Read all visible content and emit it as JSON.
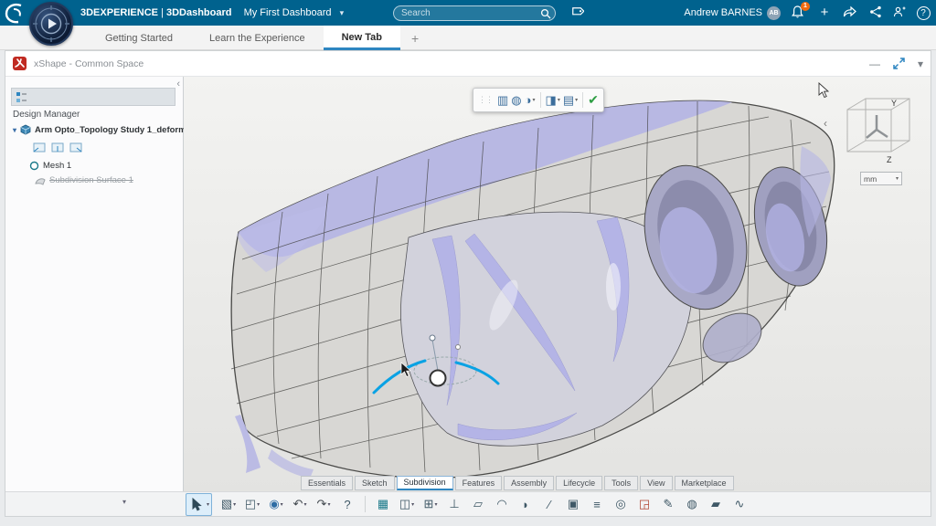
{
  "icons": {
    "caret": "▾",
    "chevron_down": "▾",
    "chevron_left": "‹",
    "plus": "+",
    "minimize": "—",
    "help": "?",
    "grip": "⋮⋮"
  },
  "topbar": {
    "brand": "3DEXPERIENCE",
    "divider": "|",
    "app": "3DDashboard",
    "dashboard": "My First Dashboard",
    "search": {
      "placeholder": "Search"
    },
    "user": {
      "name": "Andrew BARNES",
      "initials": "AB"
    },
    "notifications": {
      "count": "1"
    }
  },
  "tabbar": {
    "tabs": [
      {
        "label": "Getting Started"
      },
      {
        "label": "Learn the Experience"
      },
      {
        "label": "New Tab"
      }
    ]
  },
  "widget": {
    "title": "xShape - Common Space"
  },
  "design_manager": {
    "header": "Design Manager",
    "root_label": "Arm Opto_Topology Study 1_deform...",
    "mesh_label": "Mesh 1",
    "subdivision_label": "Subdivision Surface 1"
  },
  "viewport": {
    "axes": {
      "y": "Y",
      "z": "Z"
    },
    "units": "mm"
  },
  "top_toolbar": {
    "items": [
      {
        "name": "section-table-icon",
        "glyph": "▥"
      },
      {
        "name": "shaded-sphere-icon",
        "glyph": "◍"
      },
      {
        "name": "render-mode-icon",
        "glyph": "◑"
      },
      {
        "name": "display-style-icon",
        "glyph": "◨"
      },
      {
        "name": "layers-icon",
        "glyph": "▤"
      },
      {
        "name": "update-check-icon",
        "glyph": "✔"
      }
    ]
  },
  "section_tabs": {
    "items": [
      "Essentials",
      "Sketch",
      "Subdivision",
      "Features",
      "Assembly",
      "Lifecycle",
      "Tools",
      "View",
      "Marketplace"
    ]
  },
  "bottom_toolbar": {
    "items": [
      {
        "name": "select-tool",
        "glyph": ""
      },
      {
        "name": "subdivision-primitives-tool",
        "glyph": "▧"
      },
      {
        "name": "convert-tool",
        "glyph": "◰"
      },
      {
        "name": "sculpt-tool",
        "glyph": "◉"
      },
      {
        "name": "undo-tool",
        "glyph": "↶"
      },
      {
        "name": "redo-tool",
        "glyph": "↷"
      },
      {
        "name": "help-tool",
        "glyph": "?"
      },
      {
        "name": "mesh-box-tool",
        "glyph": "▦"
      },
      {
        "name": "subdivision-box-tool",
        "glyph": "◫"
      },
      {
        "name": "grid-pattern-tool",
        "glyph": "⊞"
      },
      {
        "name": "axis-pin-tool",
        "glyph": "⊥"
      },
      {
        "name": "plane-patch-tool",
        "glyph": "▱"
      },
      {
        "name": "arc-surface-tool",
        "glyph": "◠"
      },
      {
        "name": "petal-surface-tool",
        "glyph": "◗"
      },
      {
        "name": "split-tool",
        "glyph": "∕"
      },
      {
        "name": "trim-frame-tool",
        "glyph": "▣"
      },
      {
        "name": "offset-layers-tool",
        "glyph": "≡"
      },
      {
        "name": "cylinder-tool",
        "glyph": "◎"
      },
      {
        "name": "corner-box-tool",
        "glyph": "◲"
      },
      {
        "name": "stylus-tool",
        "glyph": "✎"
      },
      {
        "name": "wire-sphere-tool",
        "glyph": "◍"
      },
      {
        "name": "slant-plane-tool",
        "glyph": "▰"
      },
      {
        "name": "twist-surface-tool",
        "glyph": "∿"
      }
    ]
  }
}
